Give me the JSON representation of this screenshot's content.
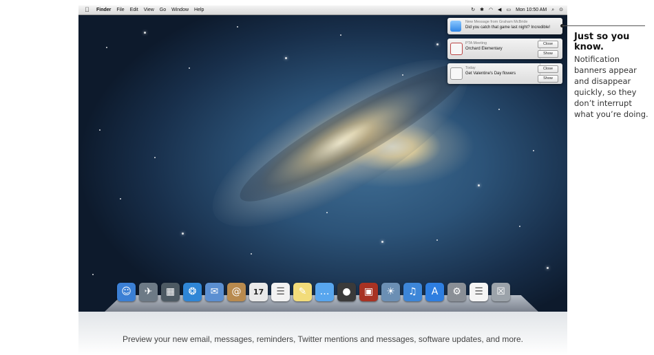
{
  "menubar": {
    "apple_icon": "apple-icon",
    "app_name": "Finder",
    "menus": [
      "File",
      "Edit",
      "View",
      "Go",
      "Window",
      "Help"
    ],
    "status_icons": [
      "time-machine-icon",
      "bluetooth-icon",
      "wifi-icon",
      "volume-icon",
      "battery-icon"
    ],
    "clock": "Mon 10:50 AM",
    "spotlight_icon": "spotlight-icon",
    "notification_center_icon": "notification-center-icon"
  },
  "notifications": [
    {
      "icon": "messages-icon",
      "title": "New Message from Graham McBride",
      "body": "Did you catch that game last night? Incredible!"
    },
    {
      "icon": "calendar-icon",
      "title": "PTA Meeting",
      "body": "Orchard Elementary",
      "buttons": [
        "Close",
        "Show"
      ]
    },
    {
      "icon": "reminders-icon",
      "title": "Today",
      "body": "Get Valentine's Day flowers",
      "buttons": [
        "Close",
        "Show"
      ]
    }
  ],
  "dock": {
    "items": [
      {
        "name": "finder-icon",
        "color": "#3b7fd4"
      },
      {
        "name": "launchpad-icon",
        "color": "#6d7a86"
      },
      {
        "name": "mission-control-icon",
        "color": "#4d5a63"
      },
      {
        "name": "safari-icon",
        "color": "#2f86d6"
      },
      {
        "name": "mail-icon",
        "color": "#5b8fd1"
      },
      {
        "name": "contacts-icon",
        "color": "#b88a4e"
      },
      {
        "name": "calendar-icon",
        "color": "#e9e9e9",
        "label": "17"
      },
      {
        "name": "reminders-icon",
        "color": "#f2f2f2"
      },
      {
        "name": "notes-icon",
        "color": "#f2dc7a"
      },
      {
        "name": "messages-icon",
        "color": "#58a6ee"
      },
      {
        "name": "facetime-icon",
        "color": "#3a3a3a"
      },
      {
        "name": "photo-booth-icon",
        "color": "#a83223"
      },
      {
        "name": "iphoto-icon",
        "color": "#6b8fb4"
      },
      {
        "name": "itunes-icon",
        "color": "#3d86d8"
      },
      {
        "name": "app-store-icon",
        "color": "#2e7ee0"
      },
      {
        "name": "system-preferences-icon",
        "color": "#8a8f96"
      },
      {
        "name": "pages-document-icon",
        "color": "#f5f5f5"
      },
      {
        "name": "trash-icon",
        "color": "#9ca3aa"
      }
    ]
  },
  "caption": "Preview your new email, messages, reminders, Twitter mentions and messages, software updates, and more.",
  "sidebar": {
    "title": "Just so you know.",
    "text": "Notification banners appear and disappear quickly, so they don’t interrupt what you’re doing."
  }
}
